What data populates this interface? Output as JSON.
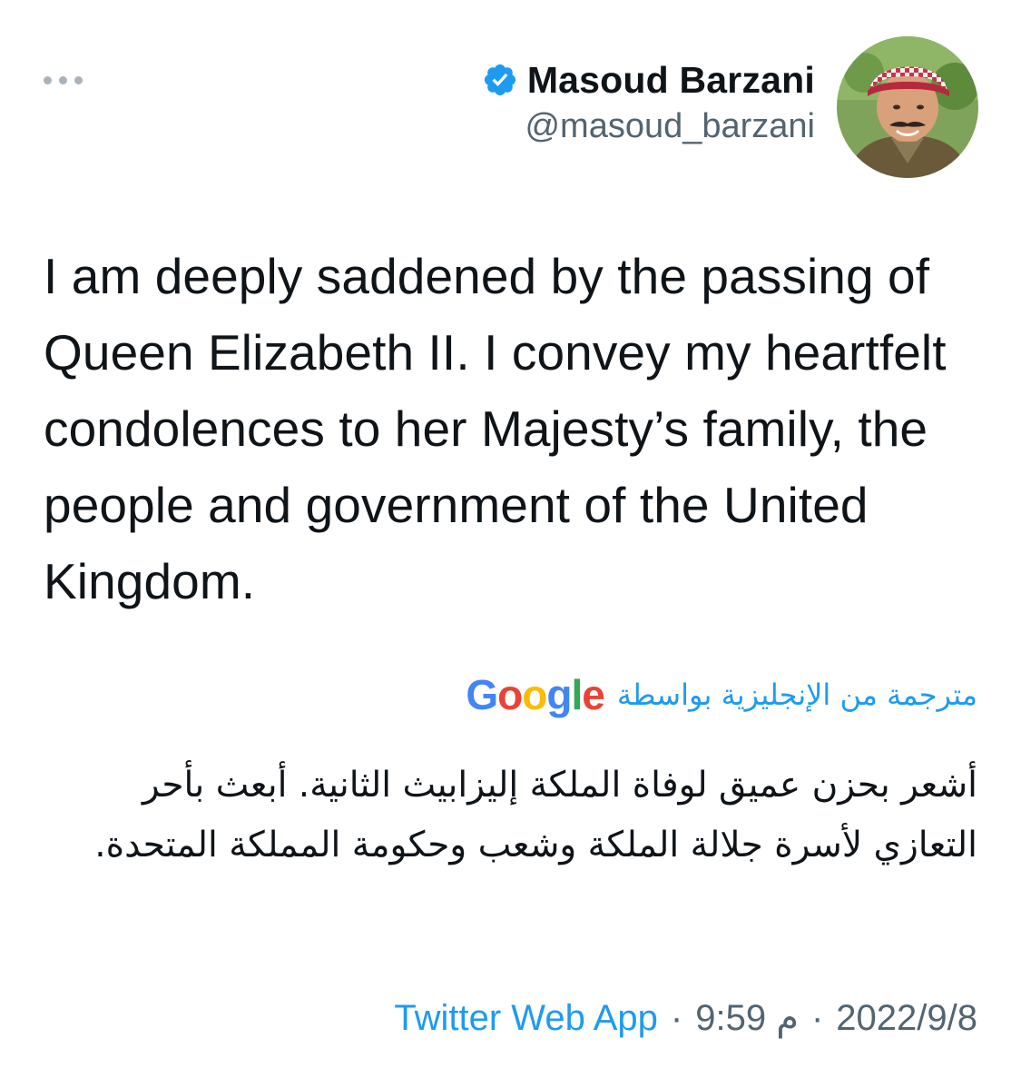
{
  "header": {
    "display_name": "Masoud Barzani",
    "handle": "@masoud_barzani",
    "verified": true,
    "more_icon": "more-horizontal-icon"
  },
  "tweet": {
    "text": "I am deeply saddened by the passing of Queen Elizabeth II. I convey my heartfelt condolences to her Majesty’s family, the people and government of the United Kingdom."
  },
  "translation": {
    "label": "مترجمة من الإنجليزية بواسطة",
    "provider": "Google",
    "text": "أشعر بحزن عميق لوفاة الملكة إليزابيث الثانية. أبعث بأحر التعازي لأسرة جلالة الملكة وشعب وحكومة المملكة المتحدة."
  },
  "meta": {
    "date": "2022/9/8",
    "separator": "·",
    "time": "9:59 م",
    "source": "Twitter Web App"
  },
  "colors": {
    "accent": "#1d9bf0",
    "text": "#0f1419",
    "secondary": "#536471",
    "verified": "#1d9bf0"
  }
}
